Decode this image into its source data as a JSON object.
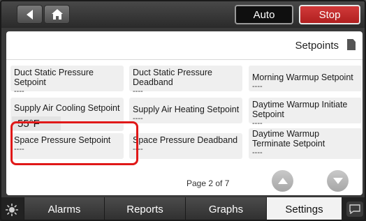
{
  "toolbar": {
    "auto_label": "Auto",
    "stop_label": "Stop",
    "back_icon": "chevron-left-icon",
    "home_icon": "home-icon",
    "colors": {
      "stop": "#c62828",
      "auto": "#0f0f0f"
    }
  },
  "header": {
    "title": "Setpoints",
    "icon": "document-icon"
  },
  "setpoints": [
    {
      "label": "Duct Static Pressure Setpoint",
      "value": "----"
    },
    {
      "label": "Duct Static Pressure Deadband",
      "value": "----"
    },
    {
      "label": "Morning Warmup Setpoint",
      "value": "----"
    },
    {
      "label": "Supply Air Cooling Setpoint",
      "value": "55°F",
      "highlighted": true
    },
    {
      "label": "Supply Air Heating Setpoint",
      "value": "----"
    },
    {
      "label": "Daytime Warmup Initiate Setpoint",
      "value": "----"
    },
    {
      "label": "Space Pressure Setpoint",
      "value": "----"
    },
    {
      "label": "Space Pressure Deadband",
      "value": "----"
    },
    {
      "label": "Daytime Warmup Terminate Setpoint",
      "value": "----"
    }
  ],
  "pagination": {
    "text": "Page 2 of 7",
    "up_icon": "chevron-up-icon",
    "down_icon": "chevron-down-icon"
  },
  "tabs": [
    {
      "label": "Alarms"
    },
    {
      "label": "Reports"
    },
    {
      "label": "Graphs"
    },
    {
      "label": "Settings",
      "active": true
    }
  ],
  "footer": {
    "left_icon": "brightness-icon",
    "right_icon": "chat-icon"
  },
  "highlight_color": "#e01818"
}
